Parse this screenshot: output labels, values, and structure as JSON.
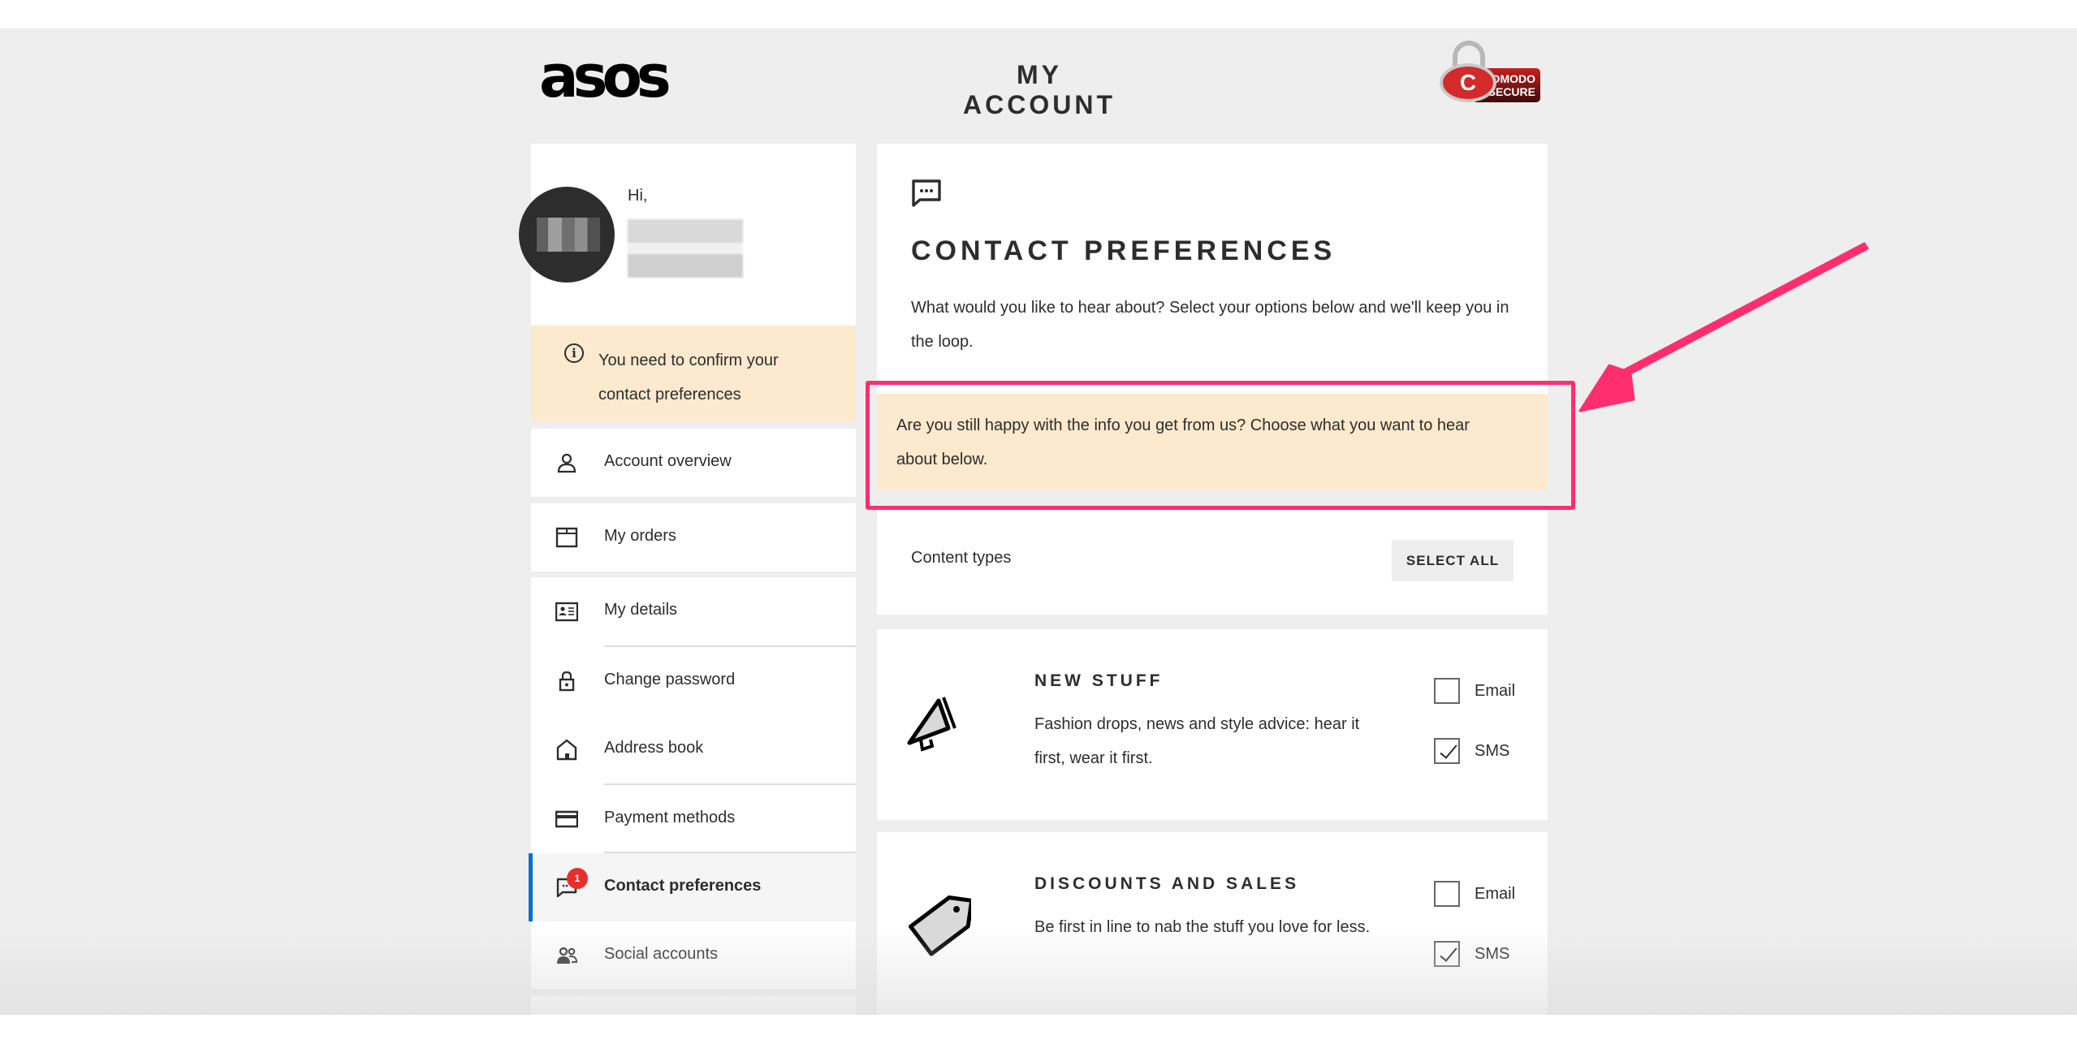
{
  "header": {
    "logo": "asos",
    "title": "MY ACCOUNT",
    "badge": {
      "line1": "COMODO",
      "line2": "SECURE",
      "letter": "C"
    }
  },
  "sidebar": {
    "greeting": "Hi,",
    "warning": "You need to confirm your contact preferences",
    "items": [
      {
        "label": "Account overview",
        "icon": "person-icon"
      },
      {
        "label": "My orders",
        "icon": "box-icon"
      },
      {
        "label": "My details",
        "icon": "id-card-icon"
      },
      {
        "label": "Change password",
        "icon": "lock-icon"
      },
      {
        "label": "Address book",
        "icon": "house-icon"
      },
      {
        "label": "Payment methods",
        "icon": "credit-card-icon"
      },
      {
        "label": "Contact preferences",
        "icon": "chat-icon",
        "active": true,
        "badge": "1"
      },
      {
        "label": "Social accounts",
        "icon": "people-icon"
      }
    ]
  },
  "main": {
    "title": "CONTACT PREFERENCES",
    "intro": "What would you like to hear about? Select your options below and we'll keep you in the loop.",
    "banner": "Are you still happy with the info you get from us? Choose what you want to hear about below.",
    "content_types_label": "Content types",
    "select_all": "SELECT ALL",
    "preferences": [
      {
        "title": "NEW STUFF",
        "description": "Fashion drops, news and style advice: hear it first, wear it first.",
        "icon": "megaphone-icon",
        "options": [
          {
            "label": "Email",
            "checked": false
          },
          {
            "label": "SMS",
            "checked": true
          }
        ]
      },
      {
        "title": "DISCOUNTS AND SALES",
        "description": "Be first in line to nab the stuff you love for less.",
        "icon": "price-tag-icon",
        "options": [
          {
            "label": "Email",
            "checked": false
          },
          {
            "label": "SMS",
            "checked": true
          }
        ]
      }
    ]
  },
  "colors": {
    "page_bg": "#eeeeee",
    "warning_bg": "#fde9cd",
    "active_accent": "#0770cf",
    "badge_red": "#e82e2e",
    "annotation": "#ff2e6e"
  }
}
